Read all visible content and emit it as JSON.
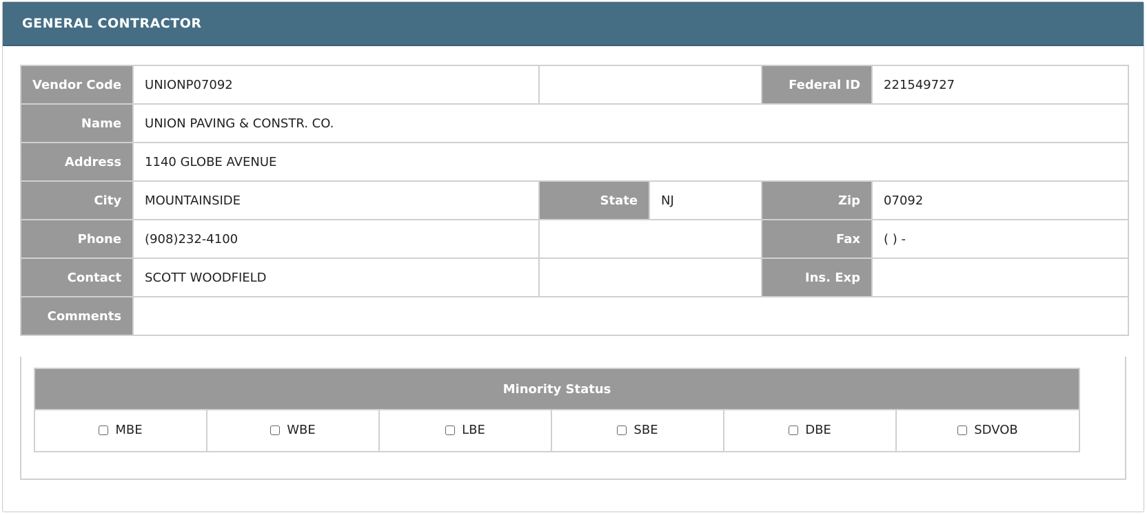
{
  "header": {
    "title": "GENERAL CONTRACTOR"
  },
  "fields": {
    "vendor_code": {
      "label": "Vendor Code",
      "value": "UNIONP07092"
    },
    "federal_id": {
      "label": "Federal ID",
      "value": "221549727"
    },
    "name": {
      "label": "Name",
      "value": "UNION PAVING & CONSTR. CO."
    },
    "address": {
      "label": "Address",
      "value": "1140 GLOBE AVENUE"
    },
    "city": {
      "label": "City",
      "value": "MOUNTAINSIDE"
    },
    "state": {
      "label": "State",
      "value": "NJ"
    },
    "zip": {
      "label": "Zip",
      "value": "07092"
    },
    "phone": {
      "label": "Phone",
      "value": "(908)232-4100"
    },
    "fax": {
      "label": "Fax",
      "value": "( ) -"
    },
    "contact": {
      "label": "Contact",
      "value": "SCOTT WOODFIELD"
    },
    "ins_exp": {
      "label": "Ins. Exp",
      "value": ""
    },
    "comments": {
      "label": "Comments",
      "value": ""
    }
  },
  "minority_status": {
    "title": "Minority Status",
    "options": [
      {
        "label": "MBE",
        "checked": false
      },
      {
        "label": "WBE",
        "checked": false
      },
      {
        "label": "LBE",
        "checked": false
      },
      {
        "label": "SBE",
        "checked": false
      },
      {
        "label": "DBE",
        "checked": false
      },
      {
        "label": "SDVOB",
        "checked": false
      }
    ]
  },
  "colors": {
    "header_bg": "#456e85",
    "label_bg": "#999999",
    "border": "#d0d0d0"
  }
}
